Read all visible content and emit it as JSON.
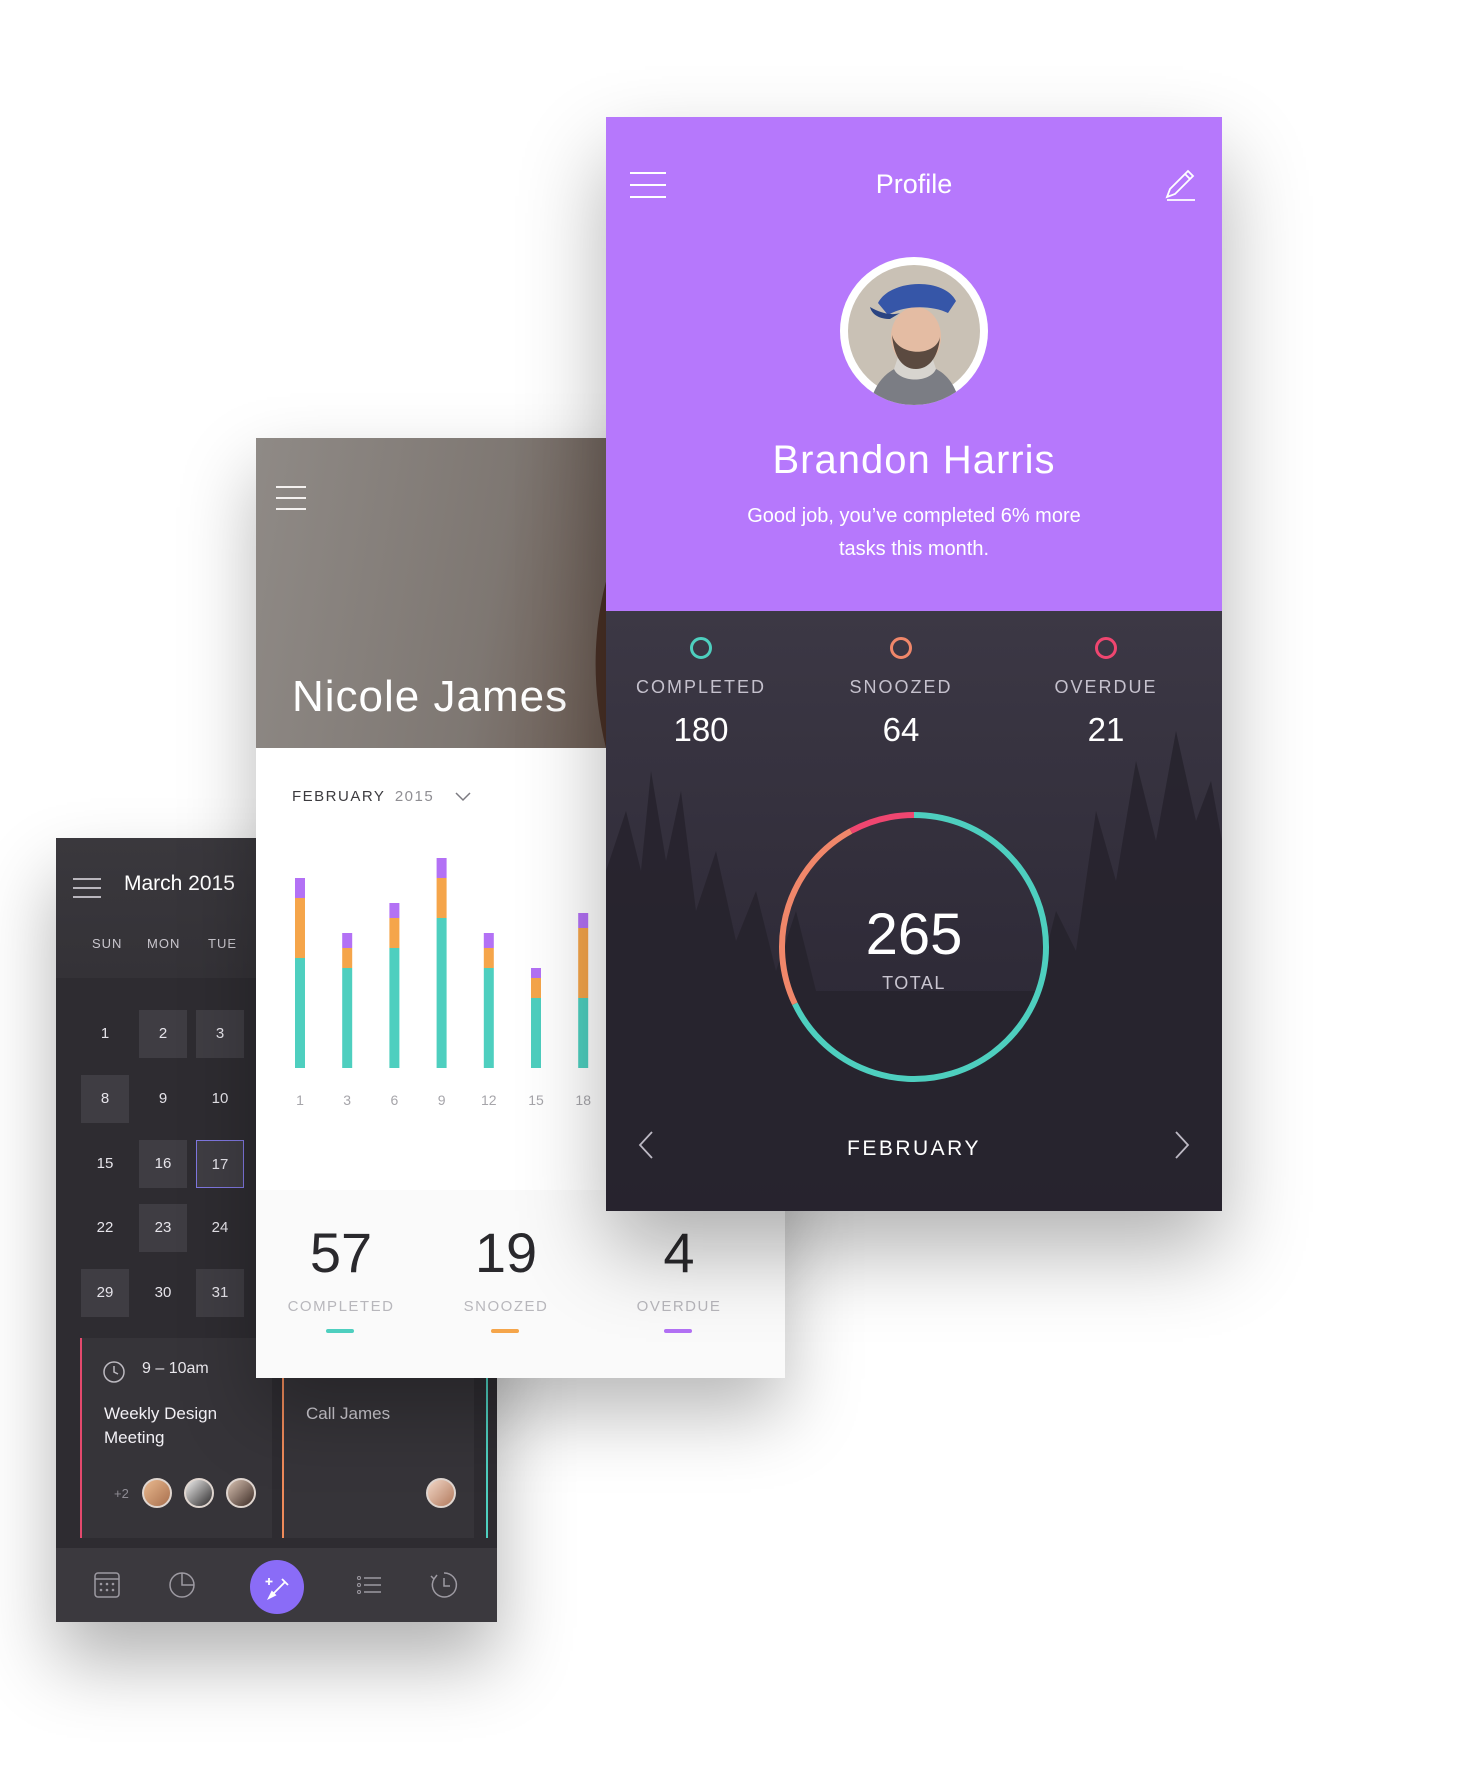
{
  "colors": {
    "purple": "#b678fc",
    "teal": "#4ecfbf",
    "orange": "#f5a54a",
    "violet": "#b371f5",
    "red": "#ef4670",
    "salmon": "#f0876a",
    "fab": "#8a6cf7"
  },
  "calendar_screen": {
    "title": "March 2015",
    "weekdays": [
      "SUN",
      "MON",
      "TUE"
    ],
    "dates": [
      "1",
      "2",
      "3",
      "8",
      "9",
      "10",
      "15",
      "16",
      "17",
      "22",
      "23",
      "24",
      "29",
      "30",
      "31"
    ],
    "selected_date": "17",
    "events": [
      {
        "time": "9 – 10am",
        "title_line1": "Weekly Design",
        "title_line2": "Meeting",
        "extra_attendees": "+2"
      },
      {
        "title": "Call James"
      }
    ],
    "nav_icons": [
      "calendar-icon",
      "pie-chart-icon",
      "new-task-icon",
      "list-icon",
      "history-icon"
    ]
  },
  "stats_screen": {
    "name": "Nicole James",
    "month": "FEBRUARY",
    "year": "2015",
    "stats": [
      {
        "value": "57",
        "label": "COMPLETED"
      },
      {
        "value": "19",
        "label": "SNOOZED"
      },
      {
        "value": "4",
        "label": "OVERDUE"
      }
    ]
  },
  "chart_data": {
    "type": "bar",
    "stacked": true,
    "categories": [
      "1",
      "3",
      "6",
      "9",
      "12",
      "15",
      "18"
    ],
    "series": [
      {
        "values": [
          11,
          10,
          12,
          15,
          10,
          7,
          7
        ]
      },
      {
        "values": [
          6,
          2,
          3,
          4,
          2,
          2,
          7
        ]
      },
      {
        "values": [
          2,
          1.5,
          1.5,
          2,
          1.5,
          1,
          1.5
        ]
      }
    ],
    "colors": [
      "#4ecfbf",
      "#f5a54a",
      "#b371f5"
    ],
    "grid": false
  },
  "profile_screen": {
    "title": "Profile",
    "name": "Brandon Harris",
    "message_line1": "Good job, you’ve completed 6% more",
    "message_line2": "tasks this month.",
    "stats": [
      {
        "label": "COMPLETED",
        "value": "180",
        "color": "#4ecfbf"
      },
      {
        "label": "SNOOZED",
        "value": "64",
        "color": "#f0876a"
      },
      {
        "label": "OVERDUE",
        "value": "21",
        "color": "#ef4670"
      }
    ],
    "total_value": "265",
    "total_label": "TOTAL",
    "month": "FEBRUARY",
    "donut": [
      {
        "value": 180,
        "color": "#4ecfbf"
      },
      {
        "value": 64,
        "color": "#f0876a"
      },
      {
        "value": 21,
        "color": "#ef4670"
      }
    ]
  }
}
